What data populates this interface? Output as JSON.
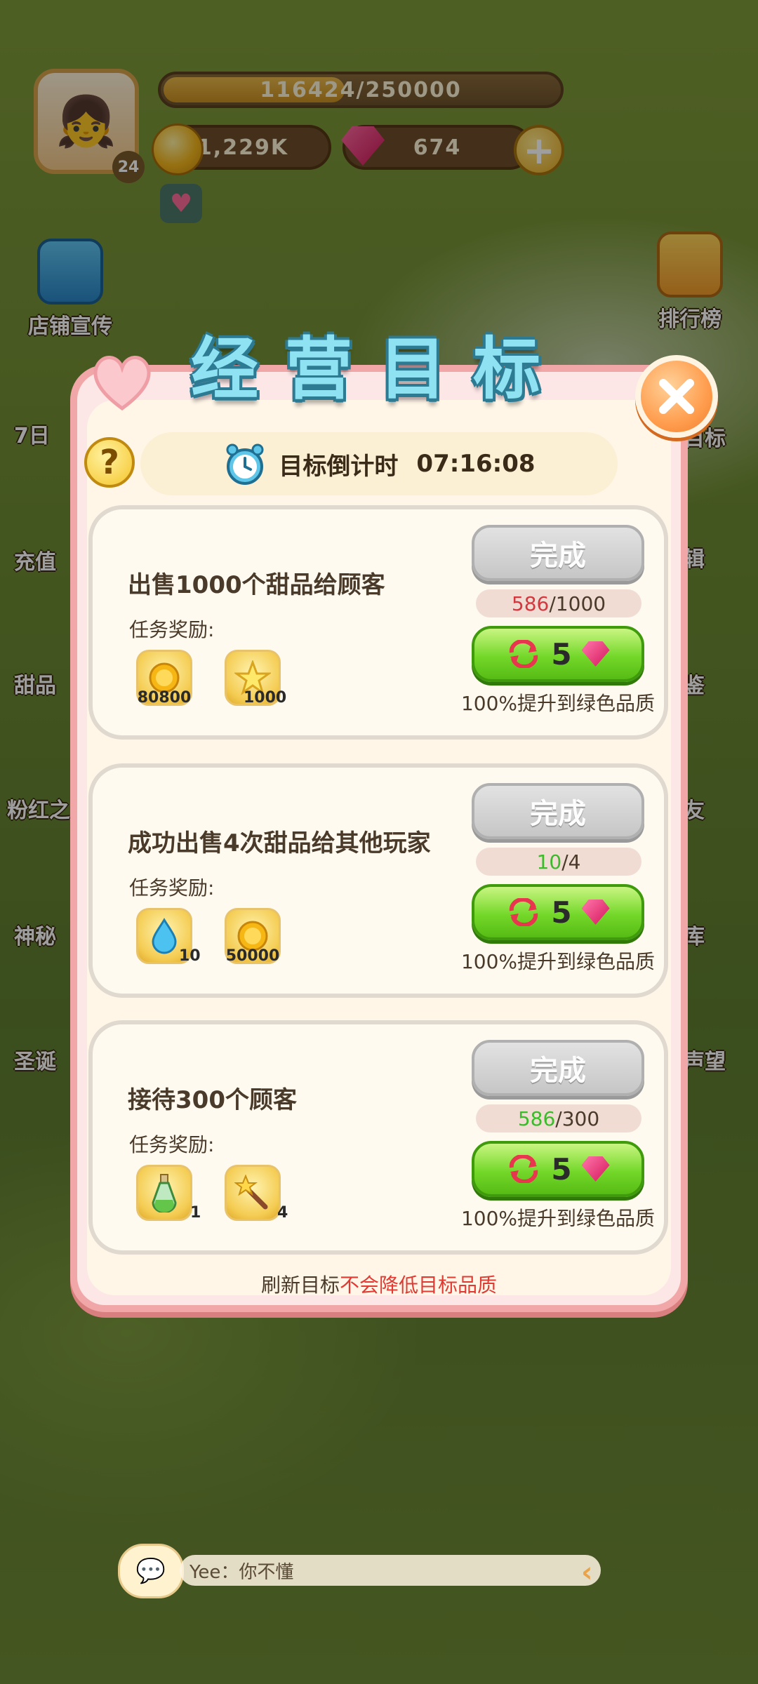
{
  "hud": {
    "xp_text": "116424/250000",
    "xp_progress": 0.466,
    "level": "24",
    "coins": "1,229K",
    "gems": "674",
    "plus_label": "+"
  },
  "side_menu": {
    "shop_promo": "店铺宣传",
    "ranking": "排行榜",
    "left_items": [
      "7日",
      "充值",
      "甜品",
      "粉红之",
      "神秘",
      "圣诞"
    ],
    "right_items": [
      "目标",
      "辑",
      "鉴",
      "友",
      "库",
      "声望"
    ]
  },
  "modal": {
    "title": "经营目标",
    "help_label": "?",
    "timer_label": "目标倒计时",
    "timer_value": "07:16:08",
    "reward_label": "任务奖励:",
    "done_label": "完成",
    "upgrade_note": "100%提升到绿色品质",
    "refresh_cost": "5",
    "footer_prefix": "刷新目标",
    "footer_highlight": "不会降低目标品质",
    "tasks": [
      {
        "title": "出售1000个甜品给顾客",
        "progress_current": "586",
        "progress_total": "/1000",
        "progress_color": "red",
        "rewards": [
          {
            "icon": "gold-coin-icon",
            "qty": "80800"
          },
          {
            "icon": "star-icon",
            "qty": "1000"
          }
        ]
      },
      {
        "title": "成功出售4次甜品给其他玩家",
        "progress_current": "10",
        "progress_total": "/4",
        "progress_color": "green",
        "rewards": [
          {
            "icon": "water-drop-icon",
            "qty": "10"
          },
          {
            "icon": "gold-coin-icon",
            "qty": "50000"
          }
        ]
      },
      {
        "title": "接待300个顾客",
        "progress_current": "586",
        "progress_total": "/300",
        "progress_color": "green",
        "rewards": [
          {
            "icon": "potion-bottle-icon",
            "qty": "1"
          },
          {
            "icon": "magic-wand-icon",
            "qty": "4"
          }
        ]
      }
    ]
  },
  "chat": {
    "message": "Yee：你不懂"
  },
  "colors": {
    "modal_border": "#f1a7a7",
    "title_fill": "#8ee2f2",
    "refresh_green": "#74d82a",
    "progress_red": "#d4383f",
    "progress_green": "#3cba2c",
    "footer_red": "#e03a33"
  }
}
